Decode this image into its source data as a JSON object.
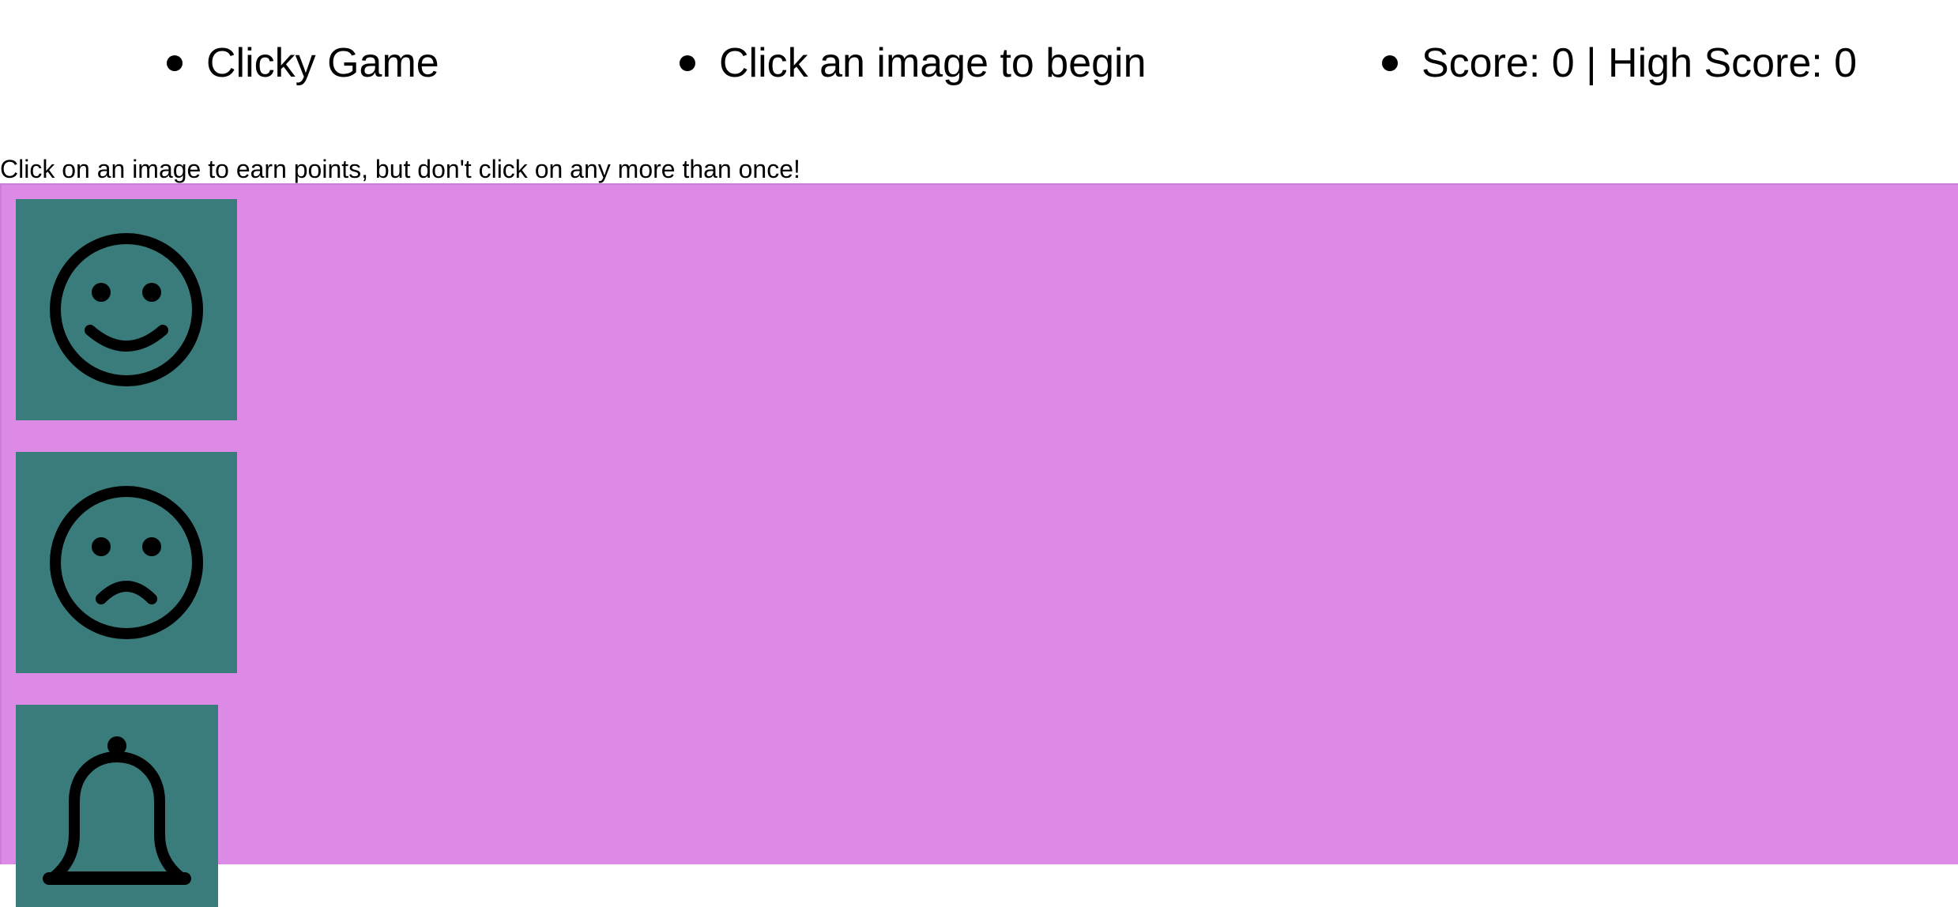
{
  "navbar": {
    "title": "Clicky Game",
    "message": "Click an image to begin",
    "score_text": "Score: 0 | High Score: 0"
  },
  "instructions": "Click on an image to earn points, but don't click on any more than once!",
  "game": {
    "board_color": "#dc8ae6",
    "card_color": "#3a7b7c",
    "cards": [
      {
        "icon": "smile-face-icon"
      },
      {
        "icon": "frown-face-icon"
      },
      {
        "icon": "bell-icon"
      }
    ]
  }
}
